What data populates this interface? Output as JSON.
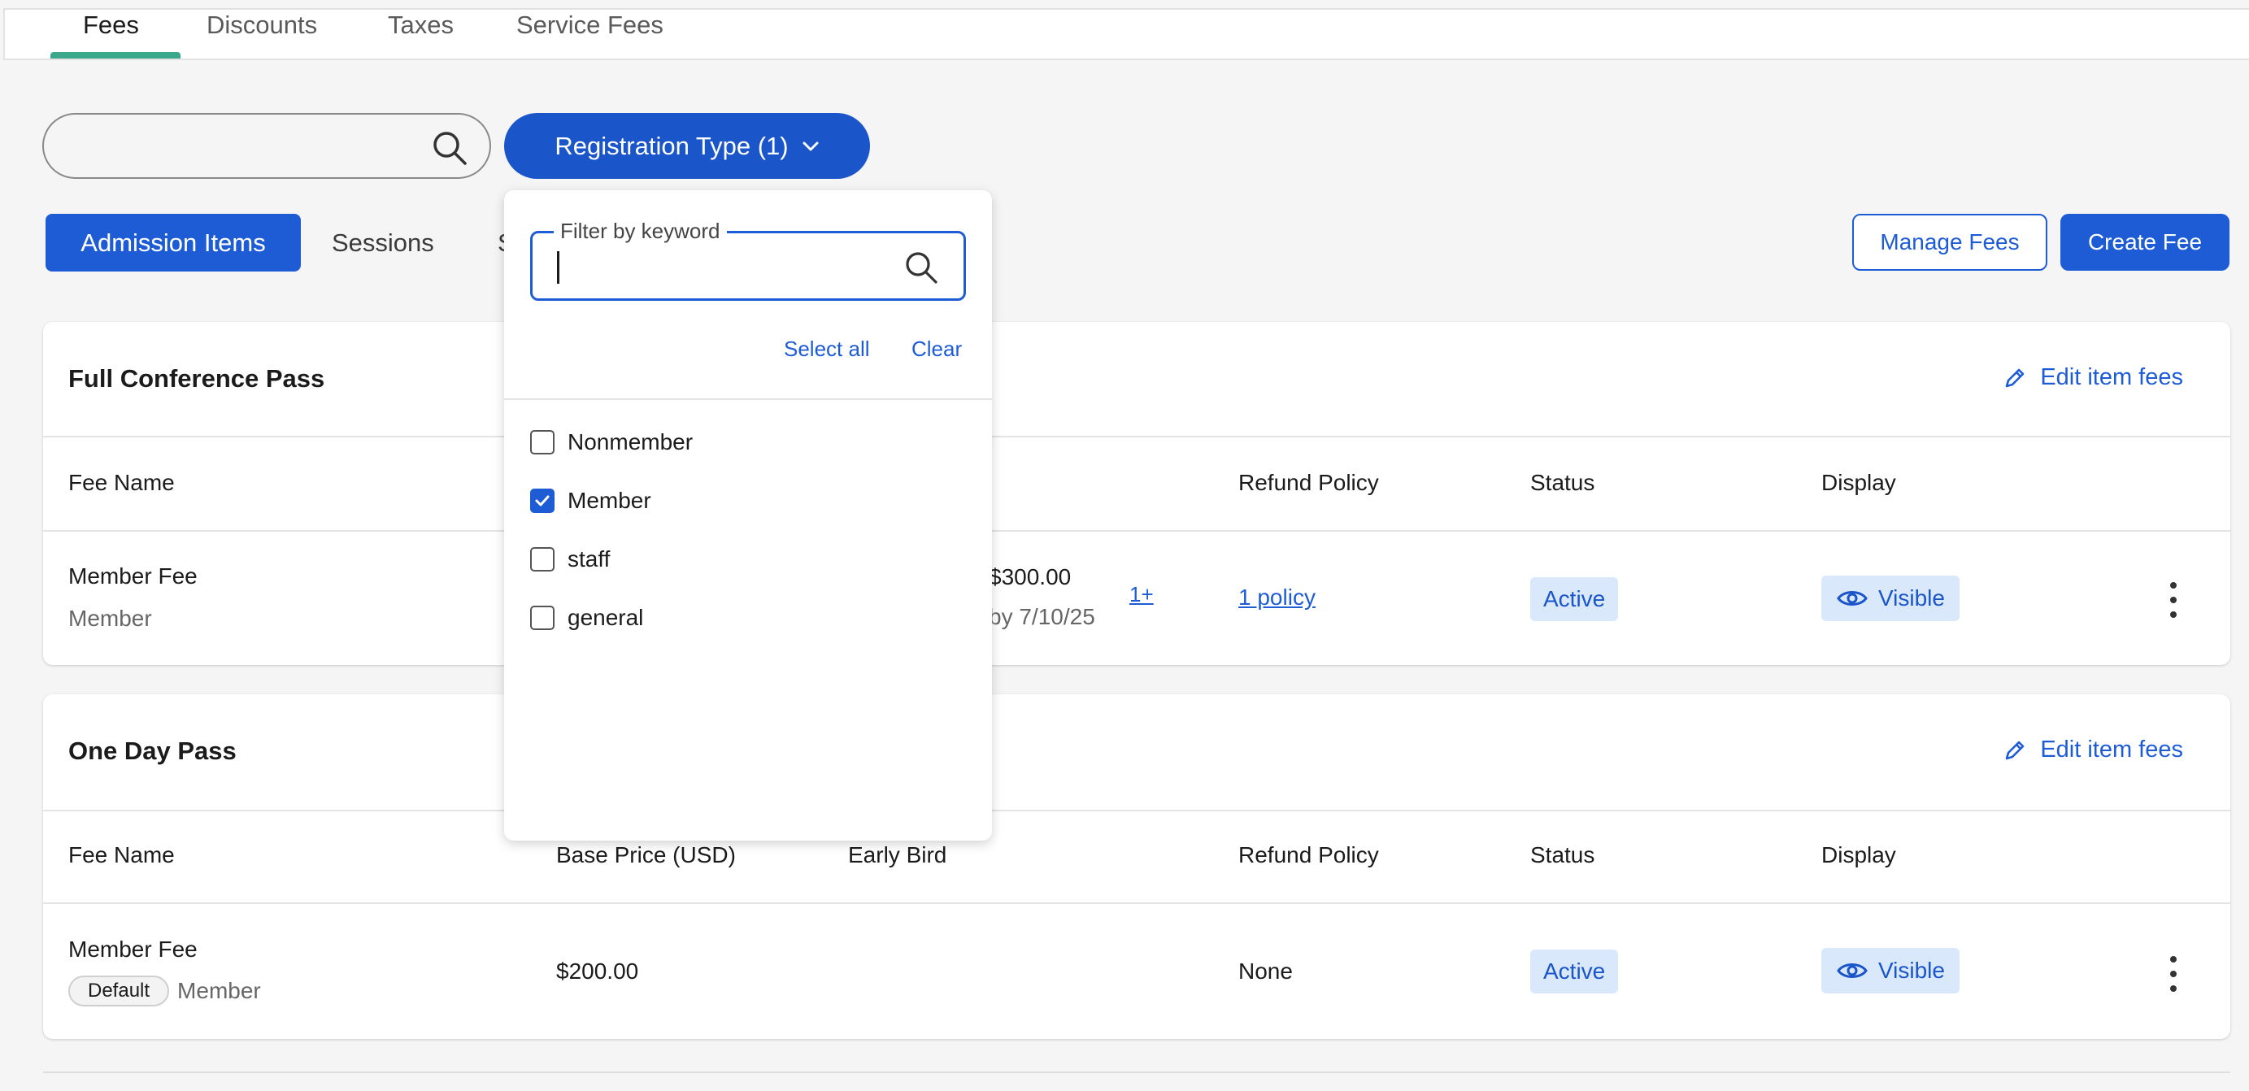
{
  "tabs": [
    "Fees",
    "Discounts",
    "Taxes",
    "Service Fees"
  ],
  "search": {
    "placeholder": ""
  },
  "filter_button": {
    "label": "Registration Type (1)"
  },
  "segments": {
    "active": "Admission Items",
    "items": [
      "Sessions",
      "S"
    ]
  },
  "actions": {
    "manage": "Manage Fees",
    "create": "Create Fee"
  },
  "dropdown": {
    "keyword_label": "Filter by keyword",
    "select_all": "Select all",
    "clear": "Clear",
    "options": [
      {
        "label": "Nonmember",
        "checked": false
      },
      {
        "label": "Member",
        "checked": true
      },
      {
        "label": "staff",
        "checked": false
      },
      {
        "label": "general",
        "checked": false
      }
    ]
  },
  "columns": {
    "fee_name": "Fee Name",
    "base_price": "Base Price (USD)",
    "early_bird": "Early Bird",
    "refund": "Refund Policy",
    "status": "Status",
    "display": "Display"
  },
  "cards": [
    {
      "title": "Full Conference Pass",
      "edit": "Edit item fees",
      "row": {
        "name": "Member Fee",
        "sub": "Member",
        "early_price": "$300.00",
        "early_date": "by 7/10/25",
        "more": "1+",
        "refund": "1 policy",
        "status": "Active",
        "display": "Visible"
      }
    },
    {
      "title": "One Day Pass",
      "edit": "Edit item fees",
      "row": {
        "name": "Member Fee",
        "chip": "Default",
        "sub": "Member",
        "base_price": "$200.00",
        "refund": "None",
        "status": "Active",
        "display": "Visible"
      }
    }
  ]
}
